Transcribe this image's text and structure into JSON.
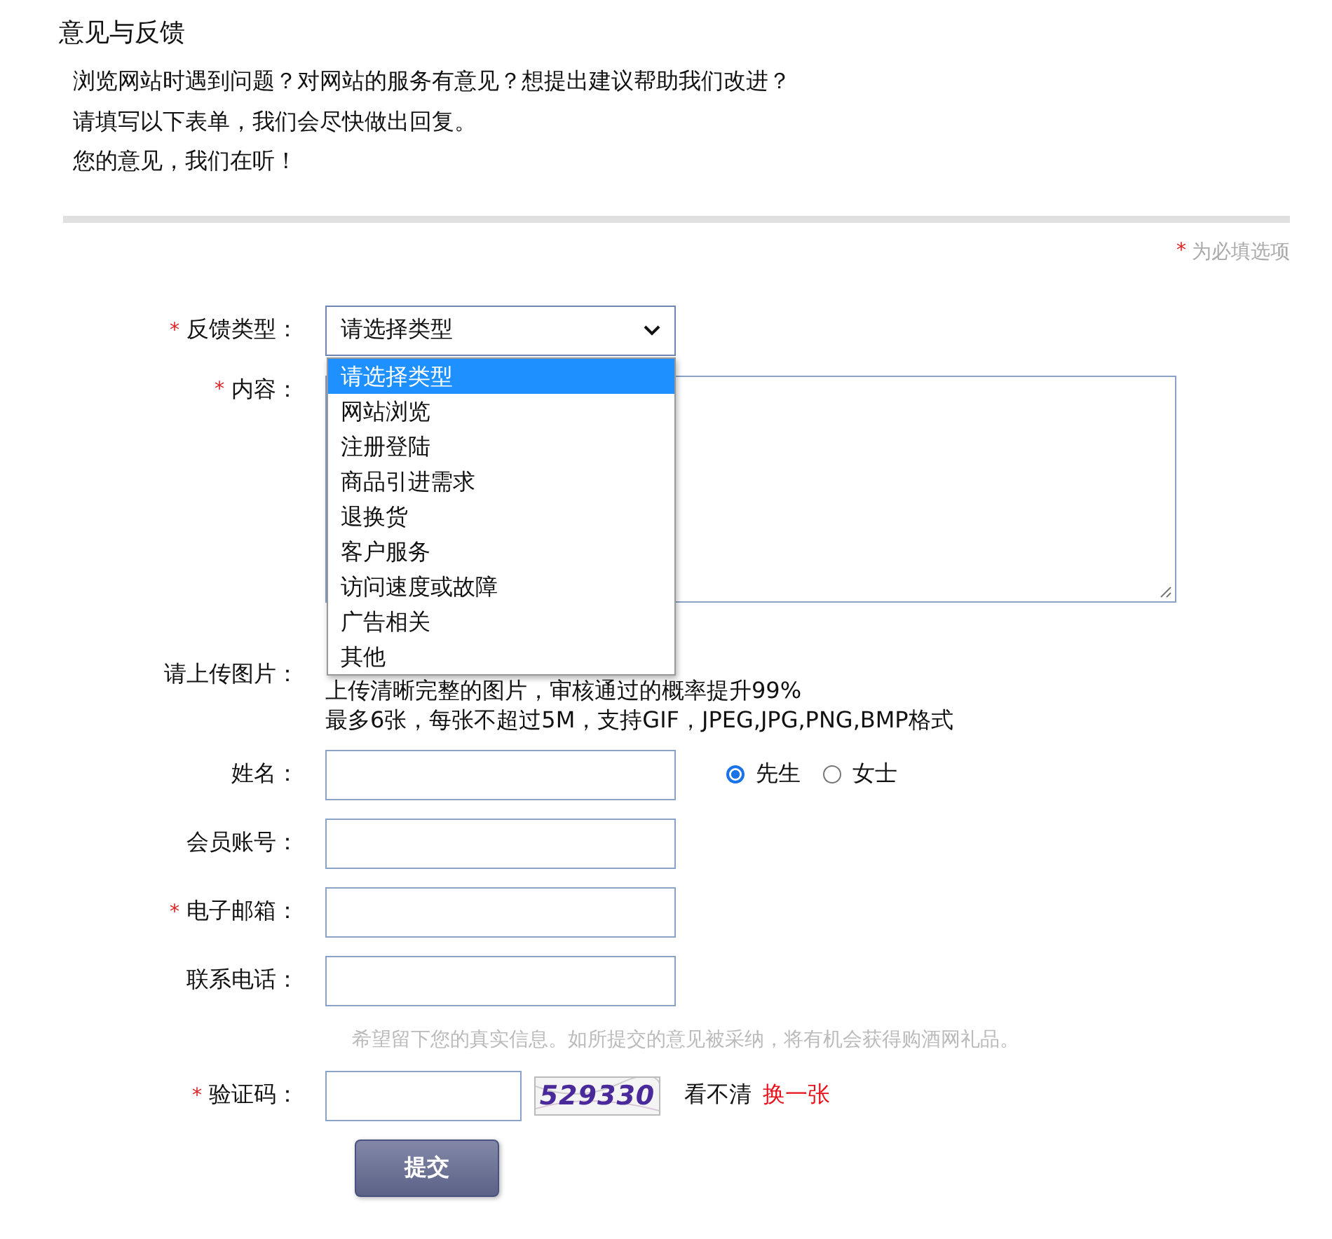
{
  "page": {
    "title": "意见与反馈",
    "intro": [
      "浏览网站时遇到问题？对网站的服务有意见？想提出建议帮助我们改进？",
      "请填写以下表单，我们会尽快做出回复。",
      "您的意见，我们在听！"
    ]
  },
  "required_note": {
    "mark": "*",
    "text": "为必填选项"
  },
  "form": {
    "fields": [
      {
        "kind": "select",
        "required_mark": "*",
        "label": "反馈类型：",
        "value": "请选择类型",
        "expanded": true,
        "options": [
          {
            "label": "请选择类型",
            "selected": true
          },
          {
            "label": "网站浏览",
            "selected": false
          },
          {
            "label": "注册登陆",
            "selected": false
          },
          {
            "label": "商品引进需求",
            "selected": false
          },
          {
            "label": "退换货",
            "selected": false
          },
          {
            "label": "客户服务",
            "selected": false
          },
          {
            "label": "访问速度或故障",
            "selected": false
          },
          {
            "label": "广告相关",
            "selected": false
          },
          {
            "label": "其他",
            "selected": false
          }
        ]
      },
      {
        "kind": "textarea",
        "required_mark": "*",
        "label": "内容："
      },
      {
        "kind": "upload",
        "label": "请上传图片：",
        "notes": [
          "上传清晰完整的图片，审核通过的概率提升99%",
          "最多6张，每张不超过5M，支持GIF，JPEG,JPG,PNG,BMP格式"
        ]
      },
      {
        "kind": "text",
        "label": "姓名：",
        "options": [
          {
            "label": "先生",
            "selected": true
          },
          {
            "label": "女士",
            "selected": false
          }
        ]
      },
      {
        "kind": "text",
        "label": "会员账号："
      },
      {
        "kind": "text",
        "required_mark": "*",
        "label": "电子邮箱："
      },
      {
        "kind": "text",
        "label": "联系电话："
      },
      {
        "kind": "hint",
        "text": "希望留下您的真实信息。如所提交的意见被采纳，将有机会获得购酒网礼品。"
      },
      {
        "kind": "captcha",
        "required_mark": "*",
        "label": "验证码：",
        "image_text": "529330",
        "unclear": "看不清",
        "refresh_link": "换一张"
      }
    ],
    "submit": "提交"
  }
}
